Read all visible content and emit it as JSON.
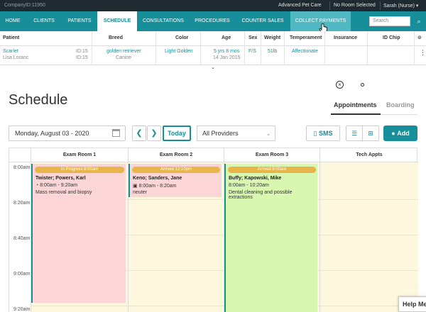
{
  "topbar": {
    "company_id": "CompanyID:11950",
    "clinic": "Advanced Pet Care",
    "room": "No Room Selected",
    "user": "Sarah (Nurse)",
    "user_chevron": "▾"
  },
  "nav": {
    "items": [
      "HOME",
      "CLIENTS",
      "PATIENTS",
      "SCHEDULE",
      "CONSULTATIONS",
      "PROCEDURES",
      "COUNTER SALES",
      "COLLECT PAYMENTS"
    ],
    "active": "SCHEDULE",
    "search_placeholder": "Search",
    "search_icon": "⌕"
  },
  "patient_table": {
    "headers": [
      "Patient",
      "Breed",
      "Color",
      "Age",
      "Sex",
      "Weight",
      "Temperament",
      "Insurance",
      "ID Chip",
      "⊙"
    ],
    "row": {
      "patient": "Scarlet",
      "owner": "Lisa Loranc",
      "id1": "ID:15",
      "id2": "ID:15",
      "breed": "golden retriever",
      "species": "Canine",
      "color": "Light Golden",
      "age": "5 yrs 8 mos",
      "dob": "14 Jan 2015",
      "sex": "F/S",
      "weight": "51lb",
      "temperament": "Affectionate",
      "more": "⋮"
    },
    "collapse_icon": "⌄"
  },
  "schedule": {
    "title": "Schedule",
    "close_icon": "×",
    "tabs": [
      "Appointments",
      "Boarding"
    ],
    "date": "Monday, August 03 - 2020",
    "prev": "❮",
    "next": "❯",
    "today": "Today",
    "provider": "All Providers",
    "provider_chevron": "⌄",
    "sms": "SMS",
    "sms_icon": "▯",
    "list_icon": "☰",
    "plus_box_icon": "⊞",
    "add": "Add",
    "add_icon": "●",
    "columns": [
      "Exam Room 1",
      "Exam Room 2",
      "Exam Room 3",
      "Tech Appts"
    ],
    "times": [
      "8:00am",
      "8:20am",
      "8:40am",
      "9:00am",
      "9:20am"
    ]
  },
  "appointments": [
    {
      "status": "In Progress 8:00am",
      "who": "Twister; Powers, Karl",
      "time": "8:00am - 9:20am",
      "time_icon": "◔",
      "desc": "Mass removal and biopsy"
    },
    {
      "status": "Arrived 12:10pm",
      "who": "Keno; Sanders, Jane",
      "time": "8:00am - 8:20am",
      "time_icon": "▣",
      "desc": "neuter"
    },
    {
      "status": "Arrived 8:00am",
      "who": "Buffy; Kapowski, Mike",
      "time": "8:00am - 10:20am",
      "time_icon": "",
      "desc": "Dental cleaning and possible extractions"
    }
  ],
  "help": "Help Me",
  "colors": {
    "teal": "#168f9a",
    "pink": "#fcd6d6",
    "green": "#d8f7b0",
    "pill": "#e8b54b",
    "cream": "#fdf7de"
  }
}
